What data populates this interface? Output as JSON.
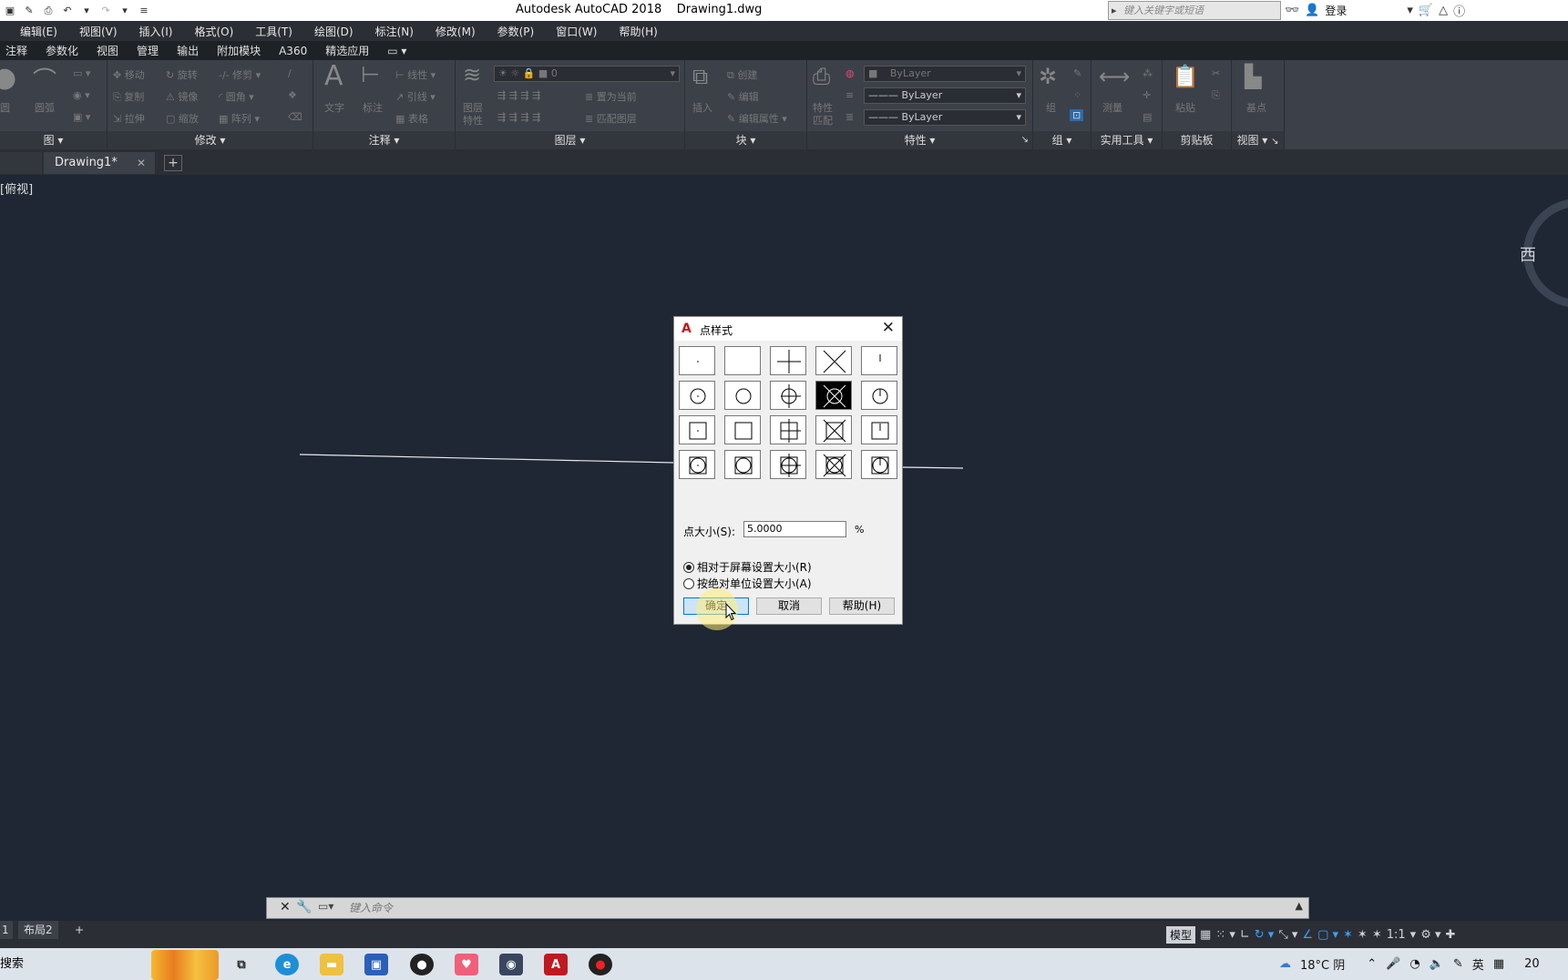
{
  "app": {
    "title": "Autodesk AutoCAD 2018",
    "document": "Drawing1.dwg",
    "search_placeholder": "键入关键字或短语",
    "login": "登录"
  },
  "menus": [
    "编辑(E)",
    "视图(V)",
    "插入(I)",
    "格式(O)",
    "工具(T)",
    "绘图(D)",
    "标注(N)",
    "修改(M)",
    "参数(P)",
    "窗口(W)",
    "帮助(H)"
  ],
  "ribbon_tabs": [
    "注释",
    "参数化",
    "视图",
    "管理",
    "输出",
    "附加模块",
    "A360",
    "精选应用"
  ],
  "ribbon": {
    "panels": [
      "图",
      "修改",
      "注释",
      "图层",
      "块",
      "特性",
      "组",
      "实用工具",
      "剪贴板",
      "视图"
    ],
    "draw": {
      "arc": "圆弧",
      "circle": "圆"
    },
    "modify": {
      "move": "移动",
      "rotate": "旋转",
      "trim": "修剪",
      "copy": "复制",
      "mirror": "镜像",
      "fillet": "圆角",
      "stretch": "拉伸",
      "scale": "缩放",
      "array": "阵列"
    },
    "annotation": {
      "text": "文字",
      "dim": "标注",
      "linear": "线性",
      "leader": "引线",
      "table": "表格"
    },
    "layers": {
      "layer_props_1": "图层",
      "layer_props_2": "特性",
      "current": "0",
      "make_current": "置为当前",
      "match": "匹配图层"
    },
    "block": {
      "insert": "插入",
      "create": "创建",
      "edit": "编辑",
      "edit_attr": "编辑属性"
    },
    "properties": {
      "match_1": "特性",
      "match_2": "匹配",
      "color": "ByLayer",
      "linetype": "ByLayer",
      "lineweight": "ByLayer"
    },
    "group": {
      "group": "组"
    },
    "utilities": {
      "measure": "测量"
    },
    "clipboard": {
      "paste": "粘贴"
    },
    "view": {
      "base": "基点"
    }
  },
  "doc_tab": {
    "name": "Drawing1*"
  },
  "viewport": {
    "label": "[俯视]",
    "cube_label": "西"
  },
  "dialog": {
    "title": "点样式",
    "size_label": "点大小(S):",
    "size_value": "5.0000",
    "size_unit": "%",
    "radio_relative": "相对于屏幕设置大小(R)",
    "radio_absolute": "按绝对单位设置大小(A)",
    "radio_selected": "relative",
    "ok": "确定",
    "cancel": "取消",
    "help": "帮助(H)",
    "selected_style_index": 8
  },
  "command_line": {
    "placeholder": "键入命令"
  },
  "layout_tabs": [
    "1",
    "布局2"
  ],
  "status": {
    "model": "模型",
    "scale": "1:1"
  },
  "taskbar": {
    "search": "搜索",
    "weather": "18°C 阴",
    "ime": "英",
    "clock": "20"
  }
}
